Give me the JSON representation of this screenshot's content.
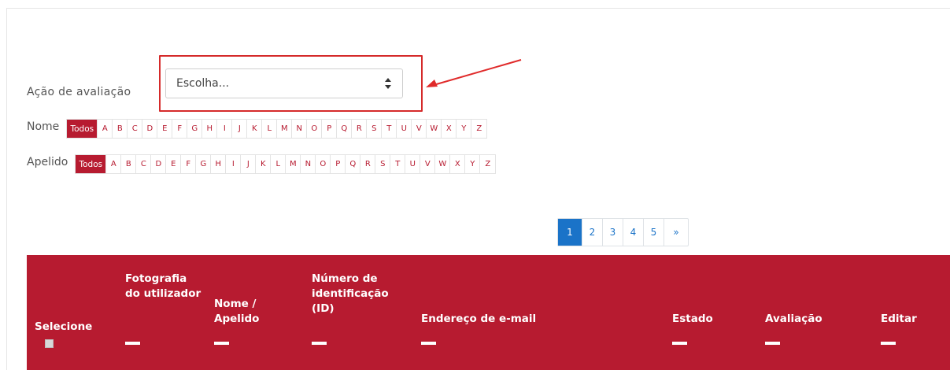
{
  "grade_action": {
    "label": "Ação de avaliação",
    "select_value": "Escolha..."
  },
  "first_name_filter": {
    "label": "Nome",
    "all": "Todos",
    "letters": [
      "A",
      "B",
      "C",
      "D",
      "E",
      "F",
      "G",
      "H",
      "I",
      "J",
      "K",
      "L",
      "M",
      "N",
      "O",
      "P",
      "Q",
      "R",
      "S",
      "T",
      "U",
      "V",
      "W",
      "X",
      "Y",
      "Z"
    ]
  },
  "last_name_filter": {
    "label": "Apelido",
    "all": "Todos",
    "letters": [
      "A",
      "B",
      "C",
      "D",
      "E",
      "F",
      "G",
      "H",
      "I",
      "J",
      "K",
      "L",
      "M",
      "N",
      "O",
      "P",
      "Q",
      "R",
      "S",
      "T",
      "U",
      "V",
      "W",
      "X",
      "Y",
      "Z"
    ]
  },
  "pagination": {
    "pages": [
      "1",
      "2",
      "3",
      "4",
      "5"
    ],
    "active": "1",
    "next": "»"
  },
  "table": {
    "headers": {
      "select": "Selecione",
      "photo": "Fotografia do utilizador",
      "name": "Nome / Apelido",
      "id_number": "Número de identificação (ID)",
      "email": "Endereço de e-mail",
      "status": "Estado",
      "grade": "Avaliação",
      "edit": "Editar"
    }
  },
  "colors": {
    "brand": "#b71b30",
    "pager_active": "#1a73c8",
    "highlight": "#d52a2a"
  }
}
